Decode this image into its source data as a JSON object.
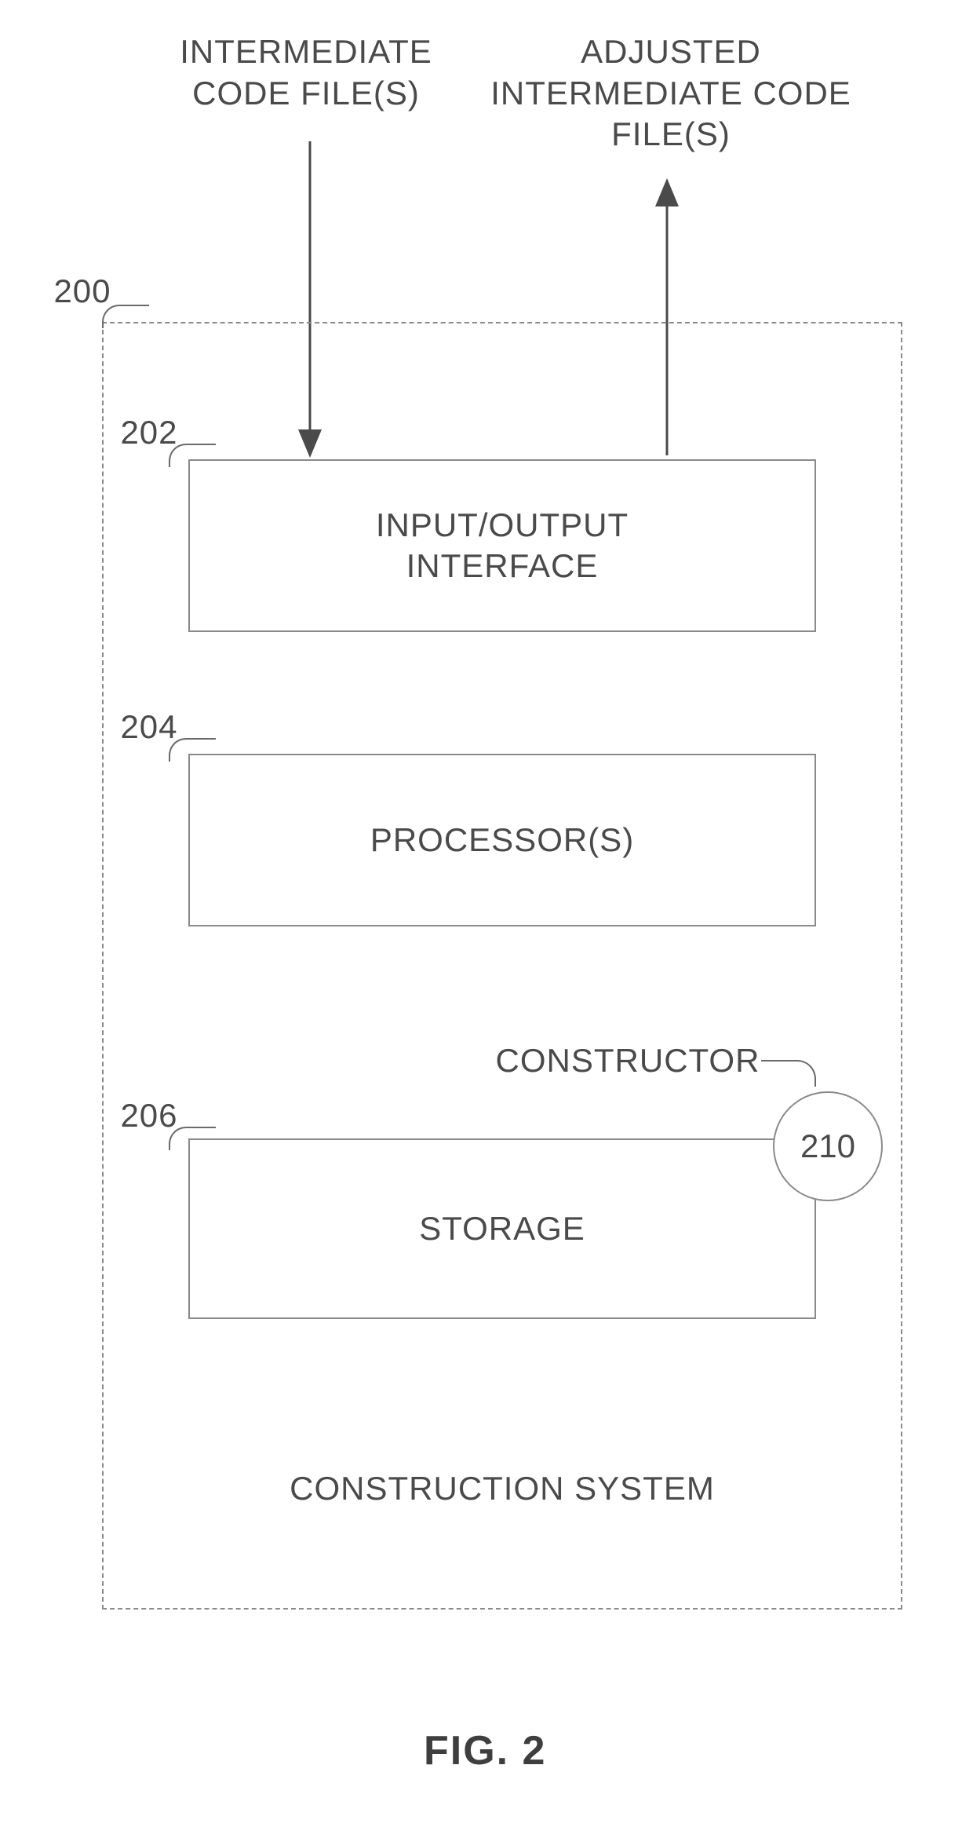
{
  "top_labels": {
    "input": "INTERMEDIATE\nCODE FILE(S)",
    "output": "ADJUSTED\nINTERMEDIATE CODE\nFILE(S)"
  },
  "refs": {
    "system": "200",
    "io": "202",
    "proc": "204",
    "storage": "206",
    "constructor": "210"
  },
  "boxes": {
    "io": "INPUT/OUTPUT\nINTERFACE",
    "proc": "PROCESSOR(S)",
    "storage": "STORAGE"
  },
  "constructor_label": "CONSTRUCTOR",
  "system_label": "CONSTRUCTION SYSTEM",
  "figure": "FIG. 2"
}
